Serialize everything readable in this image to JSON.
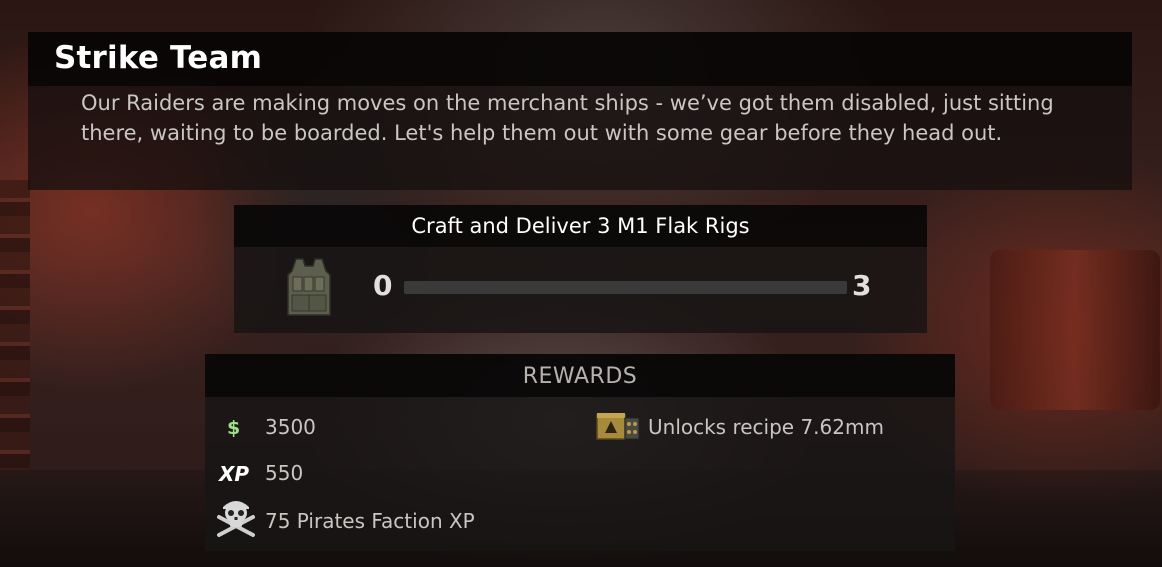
{
  "quest": {
    "title": "Strike Team",
    "description": "Our Raiders are making moves on the merchant ships - we’ve got them disabled, just sitting there, waiting to be boarded. Let's help them out with some gear before they head out."
  },
  "objective": {
    "label": "Craft and Deliver 3 M1 Flak Rigs",
    "item_icon": "flak-vest-icon",
    "progress_current": "0",
    "progress_target": "3",
    "progress_fraction": 0
  },
  "rewards": {
    "heading": "REWARDS",
    "money": {
      "icon": "dollar-icon",
      "value": "3500"
    },
    "xp": {
      "icon_label": "XP",
      "value": "550"
    },
    "faction": {
      "icon": "pirate-skull-icon",
      "value": "75 Pirates Faction XP"
    },
    "recipe": {
      "icon": "ammo-box-icon",
      "value": "Unlocks recipe 7.62mm"
    }
  },
  "colors": {
    "money_green": "#9ee08a",
    "text_primary": "#ffffff",
    "text_secondary": "#c8c5c2"
  }
}
